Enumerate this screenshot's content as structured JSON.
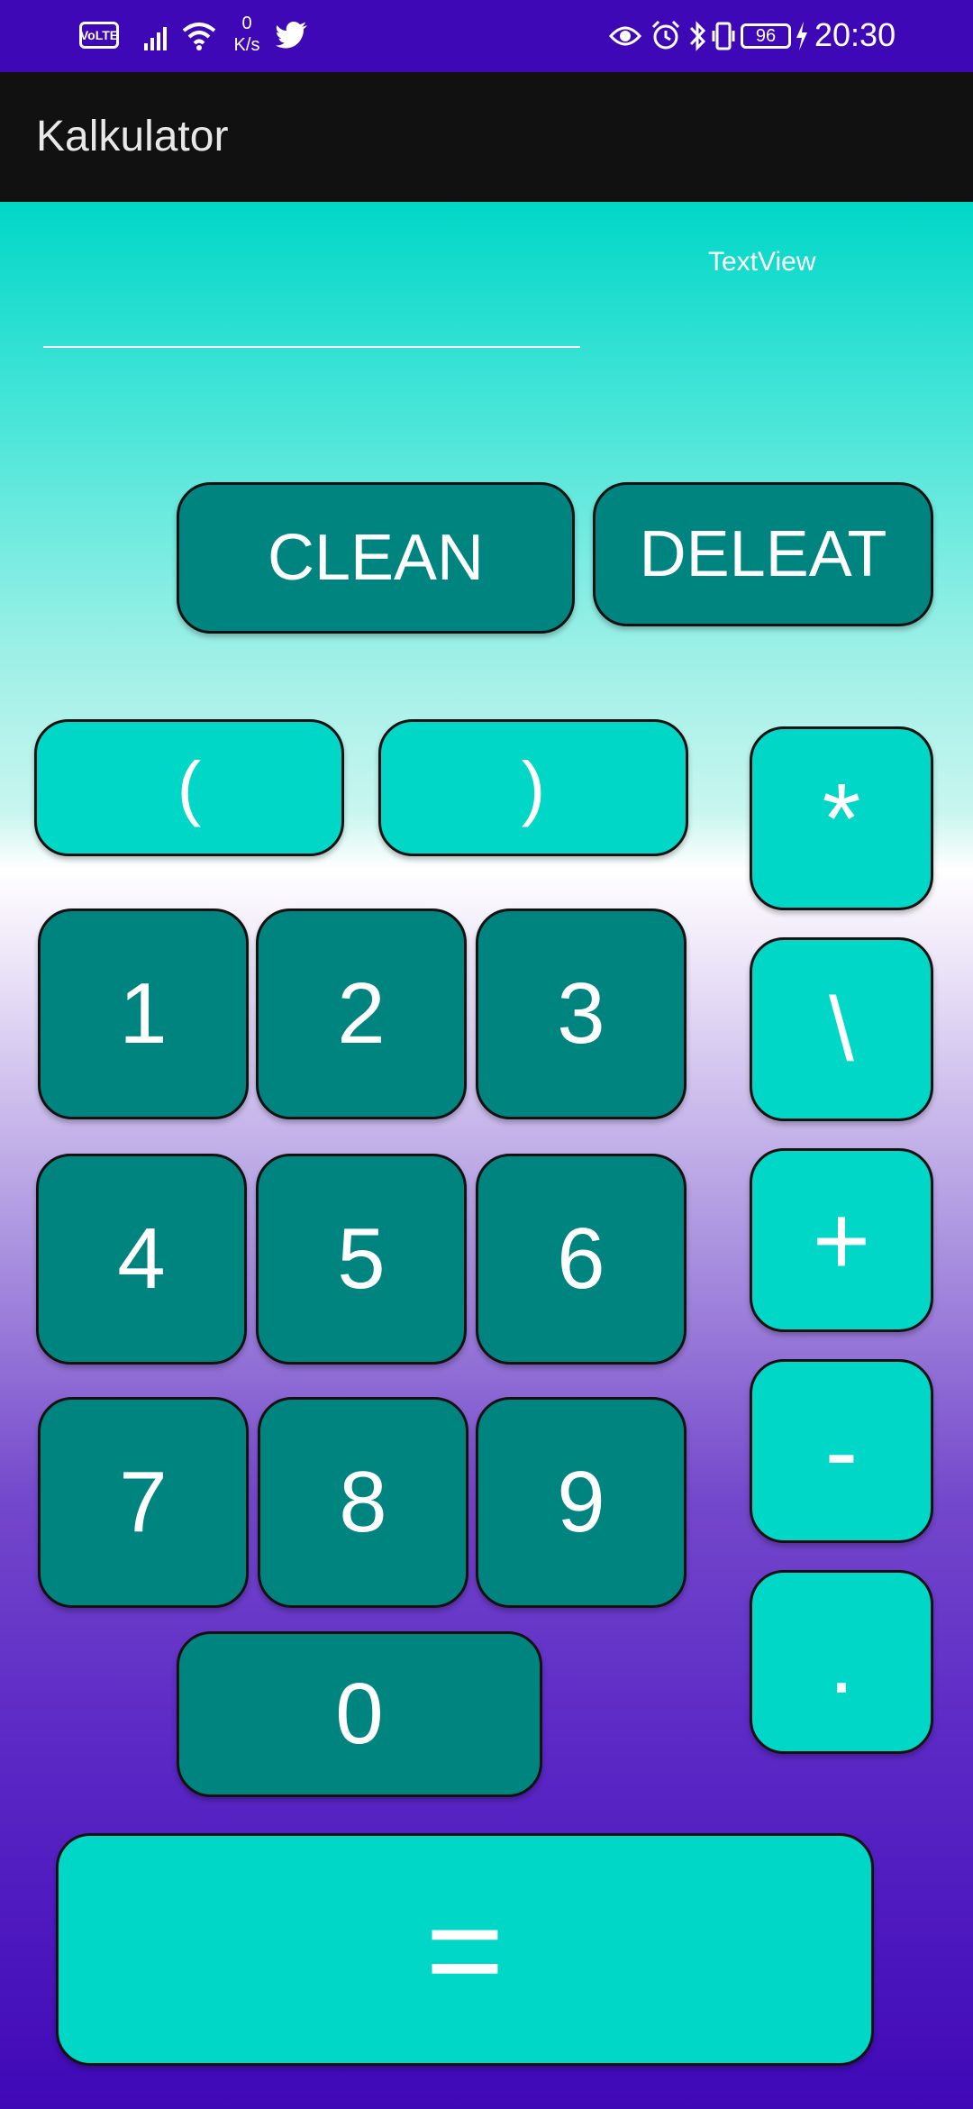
{
  "status_bar": {
    "volte": "VoLTE",
    "speed_value": "0",
    "speed_unit": "K/s",
    "battery": "96",
    "time": "20:30",
    "icons": [
      "signal-icon",
      "wifi-icon",
      "twitter-icon",
      "eye-icon",
      "alarm-icon",
      "bluetooth-icon",
      "vibrate-icon",
      "charging-icon"
    ]
  },
  "app_bar": {
    "title": "Kalkulator"
  },
  "display": {
    "result_text": "TextView",
    "input_value": ""
  },
  "buttons": {
    "clean": "CLEAN",
    "delete": "DELEAT",
    "open_paren": "(",
    "close_paren": ")",
    "multiply": "*",
    "divide": "\\",
    "plus": "+",
    "minus": "-",
    "dot": ".",
    "one": "1",
    "two": "2",
    "three": "3",
    "four": "4",
    "five": "5",
    "six": "6",
    "seven": "7",
    "eight": "8",
    "nine": "9",
    "zero": "0",
    "equals": "="
  },
  "colors": {
    "status_bar": "#3f08b7",
    "app_bar": "#111111",
    "dark_button": "#00847f",
    "light_button": "#00d7c6"
  }
}
